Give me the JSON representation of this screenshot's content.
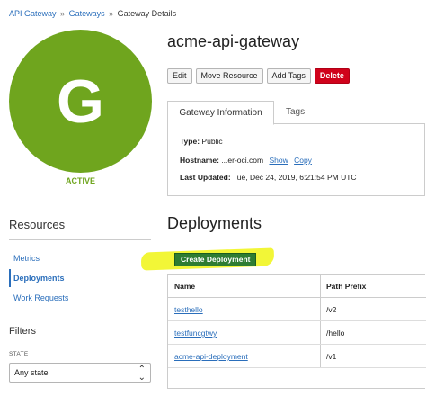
{
  "breadcrumb": {
    "root": "API Gateway",
    "section": "Gateways",
    "current": "Gateway Details",
    "separator": "»"
  },
  "gateway": {
    "avatar_letter": "G",
    "status": "ACTIVE",
    "name": "acme-api-gateway"
  },
  "actions": {
    "edit": "Edit",
    "move": "Move Resource",
    "tags": "Add Tags",
    "delete": "Delete"
  },
  "tabs": [
    "Gateway Information",
    "Tags"
  ],
  "info": {
    "type_label": "Type:",
    "type_value": "Public",
    "hostname_label": "Hostname:",
    "hostname_value": "...er-oci.com",
    "show": "Show",
    "copy": "Copy",
    "updated_label": "Last Updated:",
    "updated_value": "Tue, Dec 24, 2019, 6:21:54 PM UTC"
  },
  "resources": {
    "heading": "Resources",
    "items": [
      "Metrics",
      "Deployments",
      "Work Requests"
    ]
  },
  "filters": {
    "heading": "Filters",
    "state_label": "STATE",
    "state_value": "Any state"
  },
  "deployments": {
    "heading": "Deployments",
    "create_button": "Create Deployment",
    "columns": [
      "Name",
      "Path Prefix"
    ],
    "rows": [
      {
        "name": "testhello",
        "path": "/v2"
      },
      {
        "name": "testfuncgtwy",
        "path": "/hello"
      },
      {
        "name": "acme-api-deployment",
        "path": "/v1"
      }
    ]
  },
  "colors": {
    "accent_green": "#6fa51e",
    "link_blue": "#2a6ebb",
    "delete_red": "#d0021b",
    "create_green": "#2e7d32",
    "highlight_yellow": "#f0f514"
  }
}
